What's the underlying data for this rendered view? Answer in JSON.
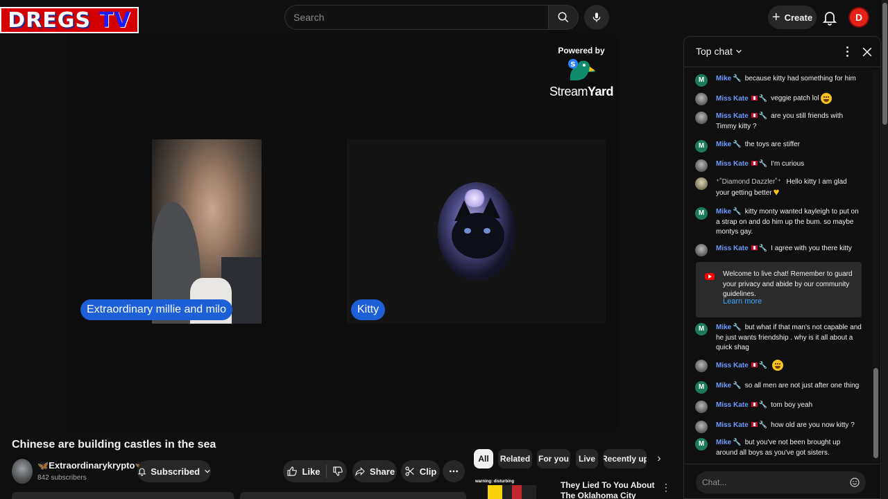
{
  "logo": {
    "word1": "DREGS",
    "word2": "TV"
  },
  "header": {
    "search_placeholder": "Search",
    "create_label": "Create",
    "user_initial": "D"
  },
  "player": {
    "powered_by": "Powered by",
    "brand_stream": "Stream",
    "brand_yard": "Yard",
    "participant1": "Extraordinary millie and milo",
    "participant2": "Kitty"
  },
  "video": {
    "title": "Chinese are building castles in the sea",
    "channel_name": "🦋Extraordinarykrypto🦋",
    "subscribers": "842 subscribers",
    "subscribed_label": "Subscribed",
    "like_label": "Like",
    "share_label": "Share",
    "clip_label": "Clip"
  },
  "chips": {
    "items": [
      {
        "label": "All"
      },
      {
        "label": "Related"
      },
      {
        "label": "For you"
      },
      {
        "label": "Live"
      },
      {
        "label": "Recently up"
      }
    ]
  },
  "recommendation": {
    "thumb_label": "warning: disturbing",
    "title": "They Lied To You About The Oklahoma City Bombing"
  },
  "chat": {
    "title": "Top chat",
    "messages": [
      {
        "author": "Mike",
        "text": "because kitty had something for him"
      },
      {
        "author": "Miss Kate",
        "text": "veggie patch lol"
      },
      {
        "author": "Miss Kate",
        "text": "are you still friends with Timmy kitty ?"
      },
      {
        "author": "Mike",
        "text": "the toys are stiffer"
      },
      {
        "author": "Miss Kate",
        "text": "I'm curious"
      },
      {
        "author": "⁺˚Diamond Dazzler˚⁺",
        "text": "Hello kitty I am glad your getting better"
      },
      {
        "author": "Mike",
        "text": "kitty monty wanted kayleigh to put on a strap on and do him up the bum. so maybe montys gay."
      },
      {
        "author": "Miss Kate",
        "text": "I agree with you there kitty"
      },
      {
        "author": "Mike",
        "text": "but what if that man's not capable and he just wants friendship . why is it all about a quick shag"
      },
      {
        "author": "Miss Kate",
        "text": ""
      },
      {
        "author": "Mike",
        "text": "so all men are not just after one thing"
      },
      {
        "author": "Miss Kate",
        "text": "tom boy yeah"
      },
      {
        "author": "Miss Kate",
        "text": "how old are you now kitty ?"
      },
      {
        "author": "Mike",
        "text": "but you've not been brought up around all boys as you've got sisters."
      }
    ],
    "welcome_text": "Welcome to live chat! Remember to guard your privacy and abide by our community guidelines.",
    "learn_more": "Learn more",
    "input_placeholder": "Chat..."
  }
}
